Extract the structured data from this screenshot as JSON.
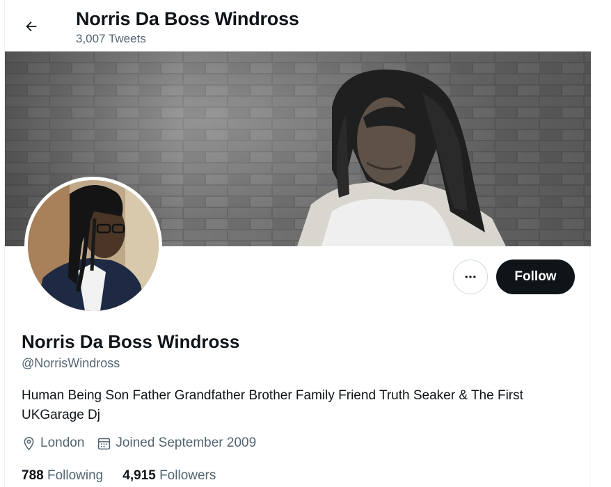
{
  "header": {
    "title": "Norris Da Boss Windross",
    "tweet_count": "3,007 Tweets",
    "back_icon": "arrow-left-icon"
  },
  "actions": {
    "more_icon": "more-dots-icon",
    "follow_label": "Follow"
  },
  "profile": {
    "name": "Norris Da Boss Windross",
    "handle": "@NorrisWindross",
    "bio": "Human Being Son Father Grandfather Brother Family Friend Truth Seaker & The First UKGarage Dj",
    "location": "London",
    "location_icon": "location-pin-icon",
    "joined": "Joined September 2009",
    "joined_icon": "calendar-icon"
  },
  "stats": {
    "following_count": "788",
    "following_label": "Following",
    "followers_count": "4,915",
    "followers_label": "Followers"
  },
  "colors": {
    "text_primary": "#0f1419",
    "text_secondary": "#536471",
    "button_dark": "#0f1419",
    "border": "#cfd9de"
  }
}
